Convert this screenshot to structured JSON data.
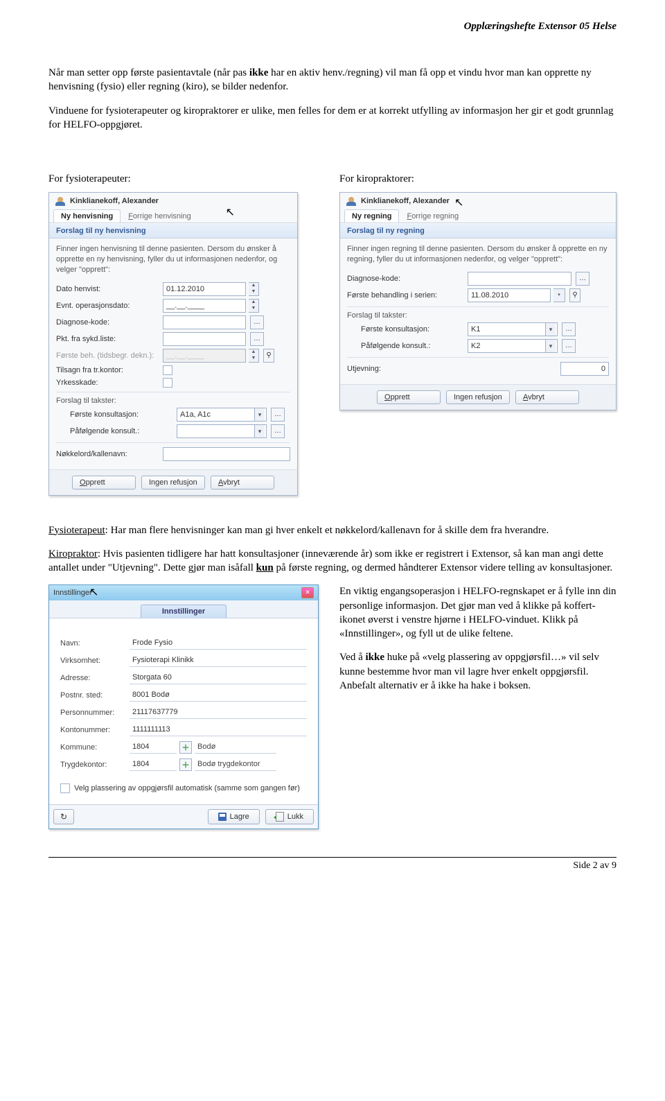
{
  "pageHeader": "Opplæringshefte Extensor 05 Helse",
  "intro": {
    "para1_prefix": "Når man setter opp første pasientavtale (når pas ",
    "para1_bold": "ikke",
    "para1_suffix": " har en aktiv henv./regning) vil man få opp et vindu hvor man kan opprette ny henvisning (fysio) eller regning (kiro), se bilder nedenfor.",
    "para2": "Vinduene for fysioterapeuter og kiropraktorer er ulike, men felles for dem er at korrekt utfylling av informasjon her gir et godt grunnlag for HELFO-oppgjøret."
  },
  "colLabels": {
    "fysio": "For fysioterapeuter:",
    "kiro": "For kiropraktorer:"
  },
  "fysio": {
    "patient": "Kinklianekoff, Alexander",
    "tab1": "Ny henvisning",
    "tab2": "Forrige henvisning",
    "strip": "Forslag til ny henvisning",
    "note": "Finner ingen henvisning til denne pasienten. Dersom du ønsker å opprette en ny henvisning, fyller du ut informasjonen nedenfor, og velger \"opprett\":",
    "fields": {
      "datoHenvist": "Dato henvist:",
      "datoHenvistVal": "01.12.2010",
      "evntOp": "Evnt. operasjonsdato:",
      "evntOpVal": "__.__.____",
      "diagKode": "Diagnose-kode:",
      "pktSyk": "Pkt. fra sykd.liste:",
      "forsteBeh": "Første beh. (tidsbegr. dekn.):",
      "forsteBehVal": "__.__.____",
      "tilsagn": "Tilsagn fra tr.kontor:",
      "yrkes": "Yrkesskade:"
    },
    "takster": {
      "head": "Forslag til takster:",
      "forste": "Første konsultasjon:",
      "forsteVal": "A1a, A1c",
      "pafolg": "Påfølgende konsult.:"
    },
    "nokkel": "Nøkkelord/kallenavn:",
    "btns": {
      "opprett": "Opprett",
      "ingen": "Ingen refusjon",
      "avbryt": "Avbryt"
    }
  },
  "kiro": {
    "patient": "Kinklianekoff, Alexander",
    "tab1": "Ny regning",
    "tab2": "Forrige regning",
    "strip": "Forslag til ny regning",
    "note": "Finner ingen regning til denne pasienten. Dersom du ønsker å opprette en ny regning, fyller du ut informasjonen nedenfor, og velger \"opprett\":",
    "diagKode": "Diagnose-kode:",
    "forsteBeh": "Første behandling i serien:",
    "forsteBehVal": "11.08.2010",
    "takster": {
      "head": "Forslag til takster:",
      "forste": "Første konsultasjon:",
      "forsteVal": "K1",
      "pafolg": "Påfølgende konsult.:",
      "pafolgVal": "K2"
    },
    "utjevning": "Utjevning:",
    "utjevningVal": "0",
    "btns": {
      "opprett": "Opprett",
      "ingen": "Ingen refusjon",
      "avbryt": "Avbryt"
    }
  },
  "middle": {
    "p1_uhead": "Fysioterapeut",
    "p1_rest": ": Har man flere henvisninger kan man gi hver enkelt et nøkkelord/kallenavn for å skille dem fra hverandre.",
    "p2_uhead": "Kiropraktor",
    "p2_a": ": Hvis pasienten tidligere har hatt konsultasjoner (inneværende år) som ikke er registrert i Extensor, så kan man angi dette antallet under \"Utjevning\". Dette gjør man isåfall ",
    "p2_bold": "kun",
    "p2_b": " på første regning, og dermed håndterer Extensor videre telling av konsultasjoner."
  },
  "settings": {
    "winTitle": "Innstillinger",
    "tab": "Innstillinger",
    "rows": {
      "navn": "Navn:",
      "navnVal": "Frode Fysio",
      "virk": "Virksomhet:",
      "virkVal": "Fysioterapi Klinikk",
      "adr": "Adresse:",
      "adrVal": "Storgata 60",
      "post": "Postnr. sted:",
      "postVal": "8001 Bodø",
      "pnr": "Personnummer:",
      "pnrVal": "21117637779",
      "konto": "Kontonummer:",
      "kontoVal": "1111111113",
      "kom": "Kommune:",
      "komVal": "1804",
      "komExtra": "Bodø",
      "trygd": "Trygdekontor:",
      "trygdVal": "1804",
      "trygdExtra": "Bodø trygdekontor"
    },
    "chk": "Velg plassering av oppgjørsfil automatisk (samme som gangen før)",
    "lagre": "Lagre",
    "lukk": "Lukk"
  },
  "rightText": {
    "p1": "En viktig engangsoperasjon i HELFO-regnskapet er å fylle inn din personlige informasjon. Det gjør man ved å klikke på koffert-ikonet øverst i venstre hjørne i HELFO-vinduet. Klikk på «Innstillinger», og fyll ut de ulike feltene.",
    "p2_a": "Ved å ",
    "p2_bold": "ikke",
    "p2_b": " huke på «velg plassering av oppgjørsfil…» vil selv kunne bestemme hvor man vil lagre hver enkelt oppgjørsfil. Anbefalt alternativ er å ikke ha hake i boksen."
  },
  "footer": "Side 2 av 9"
}
